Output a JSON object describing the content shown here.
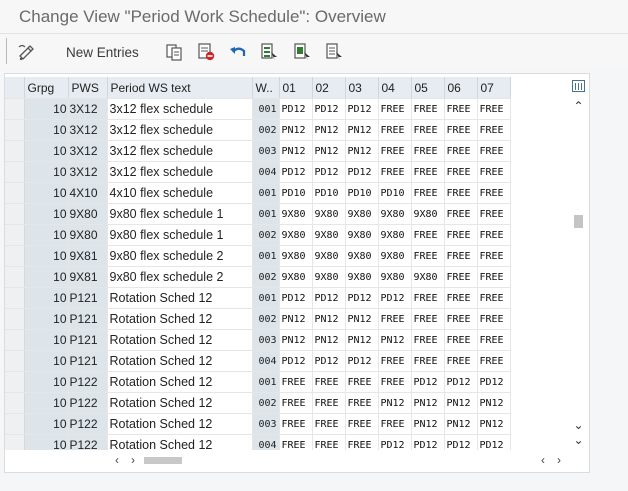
{
  "window": {
    "title": "Change View \"Period Work Schedule\": Overview"
  },
  "toolbar": {
    "new_entries_label": "New Entries",
    "icons": [
      "display-change-icon",
      "copy-icon",
      "delete-icon",
      "undo-icon",
      "select-all-icon",
      "select-block-icon",
      "deselect-all-icon"
    ]
  },
  "table": {
    "columns": [
      "Grpg",
      "PWS",
      "Period WS text",
      "W..",
      "01",
      "02",
      "03",
      "04",
      "05",
      "06",
      "07"
    ],
    "rows": [
      [
        "10",
        "3X12",
        "3x12 flex schedule",
        "001",
        "PD12",
        "PD12",
        "PD12",
        "FREE",
        "FREE",
        "FREE",
        "FREE"
      ],
      [
        "10",
        "3X12",
        "3x12 flex schedule",
        "002",
        "PN12",
        "PN12",
        "PN12",
        "FREE",
        "FREE",
        "FREE",
        "FREE"
      ],
      [
        "10",
        "3X12",
        "3x12 flex schedule",
        "003",
        "PN12",
        "PN12",
        "PN12",
        "FREE",
        "FREE",
        "FREE",
        "FREE"
      ],
      [
        "10",
        "3X12",
        "3x12 flex schedule",
        "004",
        "PD12",
        "PD12",
        "PD12",
        "FREE",
        "FREE",
        "FREE",
        "FREE"
      ],
      [
        "10",
        "4X10",
        "4x10 flex schedule",
        "001",
        "PD10",
        "PD10",
        "PD10",
        "PD10",
        "FREE",
        "FREE",
        "FREE"
      ],
      [
        "10",
        "9X80",
        "9x80 flex schedule 1",
        "001",
        "9X80",
        "9X80",
        "9X80",
        "9X80",
        "9X80",
        "FREE",
        "FREE"
      ],
      [
        "10",
        "9X80",
        "9x80 flex schedule 1",
        "002",
        "9X80",
        "9X80",
        "9X80",
        "9X80",
        "FREE",
        "FREE",
        "FREE"
      ],
      [
        "10",
        "9X81",
        "9x80 flex schedule 2",
        "001",
        "9X80",
        "9X80",
        "9X80",
        "9X80",
        "FREE",
        "FREE",
        "FREE"
      ],
      [
        "10",
        "9X81",
        "9x80 flex schedule 2",
        "002",
        "9X80",
        "9X80",
        "9X80",
        "9X80",
        "9X80",
        "FREE",
        "FREE"
      ],
      [
        "10",
        "P121",
        "Rotation Sched 12",
        "001",
        "PD12",
        "PD12",
        "PD12",
        "PD12",
        "FREE",
        "FREE",
        "FREE"
      ],
      [
        "10",
        "P121",
        "Rotation Sched 12",
        "002",
        "PN12",
        "PN12",
        "PN12",
        "FREE",
        "FREE",
        "FREE",
        "FREE"
      ],
      [
        "10",
        "P121",
        "Rotation Sched 12",
        "003",
        "PN12",
        "PN12",
        "PN12",
        "PN12",
        "FREE",
        "FREE",
        "FREE"
      ],
      [
        "10",
        "P121",
        "Rotation Sched 12",
        "004",
        "PD12",
        "PD12",
        "PD12",
        "FREE",
        "FREE",
        "FREE",
        "FREE"
      ],
      [
        "10",
        "P122",
        "Rotation Sched 12",
        "001",
        "FREE",
        "FREE",
        "FREE",
        "FREE",
        "PD12",
        "PD12",
        "PD12"
      ],
      [
        "10",
        "P122",
        "Rotation Sched 12",
        "002",
        "FREE",
        "FREE",
        "FREE",
        "PN12",
        "PN12",
        "PN12",
        "PN12"
      ],
      [
        "10",
        "P122",
        "Rotation Sched 12",
        "003",
        "FREE",
        "FREE",
        "FREE",
        "FREE",
        "PN12",
        "PN12",
        "PN12"
      ],
      [
        "10",
        "P122",
        "Rotation Sched 12",
        "004",
        "FREE",
        "FREE",
        "FREE",
        "PD12",
        "PD12",
        "PD12",
        "PD12"
      ]
    ]
  },
  "scroll": {
    "vertical_position": 0.55,
    "horizontal_position": 0.08
  },
  "colors": {
    "header_bg": "#e6ecf1",
    "key_cell_bg": "#dde4ea",
    "icon_blue": "#1f67b1",
    "icon_green": "#2e7d32",
    "icon_red": "#c62828"
  }
}
